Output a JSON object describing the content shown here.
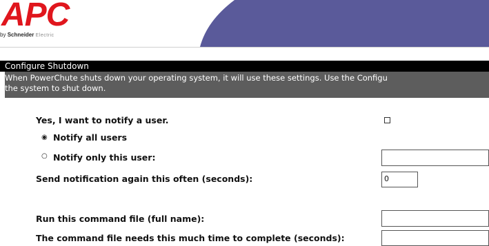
{
  "brand": {
    "name": "APC",
    "by": "by",
    "parent": "Schneider",
    "parent_suffix": "Electric",
    "colors": {
      "red": "#e0161d",
      "banner": "#5a5a9a"
    }
  },
  "section": {
    "title": "Configure Shutdown",
    "description_line1": "When PowerChute shuts down your operating system, it will use these settings. Use the Configu",
    "description_line2": "the system to shut down."
  },
  "form": {
    "notify_label": "Yes, I want to notify a user.",
    "notify_checked": false,
    "notify_all_label": "Notify all users",
    "notify_all_selected": true,
    "notify_only_label": "Notify only this user:",
    "notify_only_value": "",
    "repeat_label": "Send notification again this often (seconds):",
    "repeat_value": "0",
    "command_label": "Run this command file (full name):",
    "command_value": "",
    "time_label": "The command file needs this much time to complete (seconds):",
    "time_value": ""
  },
  "icons": {
    "radio_selected": "radio-selected-icon",
    "radio_empty": "radio-empty-icon"
  }
}
